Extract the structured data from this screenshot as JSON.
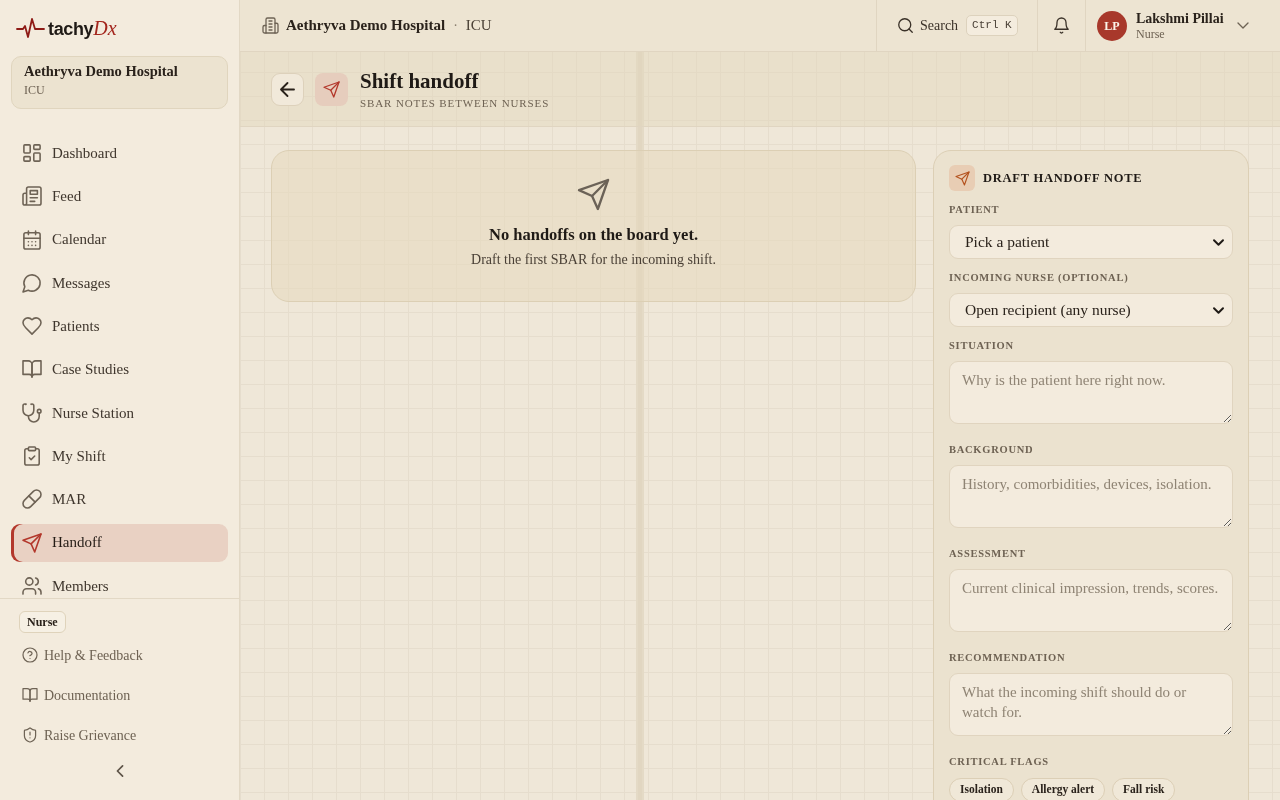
{
  "brand": {
    "name": "tachy",
    "suffix": "Dx"
  },
  "sidebar": {
    "workspace": {
      "name": "Aethryva Demo Hospital",
      "unit": "ICU"
    },
    "items": [
      {
        "label": "Dashboard",
        "selected": false
      },
      {
        "label": "Feed",
        "selected": false
      },
      {
        "label": "Calendar",
        "selected": false
      },
      {
        "label": "Messages",
        "selected": false
      },
      {
        "label": "Patients",
        "selected": false
      },
      {
        "label": "Case Studies",
        "selected": false
      },
      {
        "label": "Nurse Station",
        "selected": false
      },
      {
        "label": "My Shift",
        "selected": false
      },
      {
        "label": "MAR",
        "selected": false
      },
      {
        "label": "Handoff",
        "selected": true
      },
      {
        "label": "Members",
        "selected": false
      }
    ],
    "role_badge": "Nurse",
    "footer_links": [
      "Help & Feedback",
      "Documentation",
      "Raise Grievance"
    ]
  },
  "header": {
    "workspace": "Aethryva Demo Hospital",
    "separator": "·",
    "unit": "ICU",
    "search": {
      "label": "Search",
      "shortcut": "Ctrl K"
    },
    "user": {
      "initials": "LP",
      "name": "Lakshmi Pillai",
      "role": "Nurse"
    }
  },
  "page": {
    "title": "Shift handoff",
    "subtitle": "SBAR NOTES BETWEEN NURSES"
  },
  "empty_state": {
    "title": "No handoffs on the board yet.",
    "message": "Draft the first SBAR for the incoming shift."
  },
  "draft_form": {
    "title": "DRAFT HANDOFF NOTE",
    "fields": [
      {
        "kind": "select",
        "label": "PATIENT",
        "value": "Pick a patient"
      },
      {
        "kind": "select",
        "label": "INCOMING NURSE (OPTIONAL)",
        "value": "Open recipient (any nurse)"
      },
      {
        "kind": "textarea",
        "label": "SITUATION",
        "placeholder": "Why is the patient here right now."
      },
      {
        "kind": "textarea",
        "label": "BACKGROUND",
        "placeholder": "History, comorbidities, devices, isolation."
      },
      {
        "kind": "textarea",
        "label": "ASSESSMENT",
        "placeholder": "Current clinical impression, trends, scores."
      },
      {
        "kind": "textarea",
        "label": "RECOMMENDATION",
        "placeholder": "What the incoming shift should do or watch for."
      }
    ],
    "flags": {
      "label": "CRITICAL FLAGS",
      "options": [
        {
          "label": "Isolation",
          "selected": false
        },
        {
          "label": "Allergy alert",
          "selected": false
        },
        {
          "label": "Fall risk",
          "selected": false
        }
      ]
    }
  }
}
